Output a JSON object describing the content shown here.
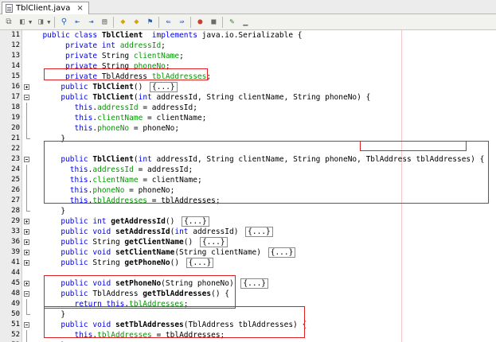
{
  "tab": {
    "label": "TblClient.java",
    "close": "×"
  },
  "toolbar": {
    "icons": [
      "history-icon",
      "back-icon",
      "forward-icon",
      "find-icon",
      "find-prev-icon",
      "find-next-icon",
      "toggle-highlight-icon",
      "prev-bookmark-icon",
      "next-bookmark-icon",
      "toggle-bookmark-icon",
      "shift-left-icon",
      "shift-right-icon",
      "record-macro-icon",
      "stop-macro-icon",
      "comment-icon",
      "uncomment-icon"
    ]
  },
  "editor": {
    "lines": [
      {
        "n": "11",
        "fold": "",
        "indent": "  ",
        "tokens": [
          [
            "kw",
            "public class "
          ],
          [
            "b",
            "TblClient"
          ],
          [
            "",
            "  "
          ],
          [
            "kw",
            "implements"
          ],
          [
            "",
            " java.io.Serializable {"
          ]
        ]
      },
      {
        "n": "12",
        "fold": "",
        "indent": "       ",
        "tokens": [
          [
            "kw",
            "private int "
          ],
          [
            "fld",
            "addressId"
          ],
          [
            "",
            ";"
          ]
        ]
      },
      {
        "n": "13",
        "fold": "",
        "indent": "       ",
        "tokens": [
          [
            "kw",
            "private "
          ],
          [
            "",
            "String "
          ],
          [
            "fld",
            "clientName"
          ],
          [
            "",
            ";"
          ]
        ]
      },
      {
        "n": "14",
        "fold": "",
        "indent": "       ",
        "tokens": [
          [
            "kw",
            "private "
          ],
          [
            "",
            "String "
          ],
          [
            "fld",
            "phoneNo"
          ],
          [
            "",
            ";"
          ]
        ]
      },
      {
        "n": "15",
        "fold": "",
        "indent": "       ",
        "tokens": [
          [
            "kw",
            "private "
          ],
          [
            "",
            "TblAddress "
          ],
          [
            "fld",
            "tblAddresses"
          ],
          [
            "",
            ";"
          ]
        ]
      },
      {
        "n": "16",
        "fold": "plus",
        "indent": "      ",
        "tokens": [
          [
            "kw",
            "public "
          ],
          [
            "b",
            "TblClient"
          ],
          [
            "",
            "() "
          ]
        ],
        "collapsed": "{...}"
      },
      {
        "n": "17",
        "fold": "minus",
        "indent": "      ",
        "tokens": [
          [
            "kw",
            "public "
          ],
          [
            "b",
            "TblClient"
          ],
          [
            "",
            "("
          ],
          [
            "kw",
            "int"
          ],
          [
            "",
            " addressId, String clientName, String phoneNo) {"
          ]
        ]
      },
      {
        "n": "18",
        "fold": "",
        "indent": "         ",
        "tokens": [
          [
            "kw",
            "this"
          ],
          [
            "",
            "."
          ],
          [
            "fld",
            "addressId"
          ],
          [
            "",
            " = addressId;"
          ]
        ]
      },
      {
        "n": "19",
        "fold": "",
        "indent": "         ",
        "tokens": [
          [
            "kw",
            "this"
          ],
          [
            "",
            "."
          ],
          [
            "fld",
            "clientName"
          ],
          [
            "",
            " = clientName;"
          ]
        ]
      },
      {
        "n": "20",
        "fold": "",
        "indent": "         ",
        "tokens": [
          [
            "kw",
            "this"
          ],
          [
            "",
            "."
          ],
          [
            "fld",
            "phoneNo"
          ],
          [
            "",
            " = phoneNo;"
          ]
        ]
      },
      {
        "n": "21",
        "fold": "end",
        "indent": "      ",
        "tokens": [
          [
            "",
            "}"
          ]
        ]
      },
      {
        "n": "22",
        "fold": "",
        "indent": "",
        "tokens": []
      },
      {
        "n": "23",
        "fold": "minus",
        "indent": "      ",
        "tokens": [
          [
            "kw",
            "public "
          ],
          [
            "b",
            "TblClient"
          ],
          [
            "",
            "("
          ],
          [
            "kw",
            "int"
          ],
          [
            "",
            " addressId, String clientName, String phoneNo, TblAddress tblAddresses) {"
          ]
        ]
      },
      {
        "n": "24",
        "fold": "",
        "indent": "        ",
        "tokens": [
          [
            "kw",
            "this"
          ],
          [
            "",
            "."
          ],
          [
            "fld",
            "addressId"
          ],
          [
            "",
            " = addressId;"
          ]
        ]
      },
      {
        "n": "25",
        "fold": "",
        "indent": "        ",
        "tokens": [
          [
            "kw",
            "this"
          ],
          [
            "",
            "."
          ],
          [
            "fld",
            "clientName"
          ],
          [
            "",
            " = clientName;"
          ]
        ]
      },
      {
        "n": "26",
        "fold": "",
        "indent": "        ",
        "tokens": [
          [
            "kw",
            "this"
          ],
          [
            "",
            "."
          ],
          [
            "fld",
            "phoneNo"
          ],
          [
            "",
            " = phoneNo;"
          ]
        ]
      },
      {
        "n": "27",
        "fold": "",
        "indent": "        ",
        "tokens": [
          [
            "kw",
            "this"
          ],
          [
            "",
            "."
          ],
          [
            "fld",
            "tblAddresses"
          ],
          [
            "",
            " = tblAddresses;"
          ]
        ]
      },
      {
        "n": "28",
        "fold": "end",
        "indent": "      ",
        "tokens": [
          [
            "",
            "}"
          ]
        ]
      },
      {
        "n": "29",
        "fold": "plus",
        "indent": "      ",
        "tokens": [
          [
            "kw",
            "public int "
          ],
          [
            "b",
            "getAddressId"
          ],
          [
            "",
            "() "
          ]
        ],
        "collapsed": "{...}"
      },
      {
        "n": "33",
        "fold": "plus",
        "indent": "      ",
        "tokens": [
          [
            "kw",
            "public void "
          ],
          [
            "b",
            "setAddressId"
          ],
          [
            "",
            "("
          ],
          [
            "kw",
            "int"
          ],
          [
            "",
            " addressId) "
          ]
        ],
        "collapsed": "{...}"
      },
      {
        "n": "36",
        "fold": "plus",
        "indent": "      ",
        "tokens": [
          [
            "kw",
            "public "
          ],
          [
            "",
            "String "
          ],
          [
            "b",
            "getClientName"
          ],
          [
            "",
            "() "
          ]
        ],
        "collapsed": "{...}"
      },
      {
        "n": "39",
        "fold": "plus",
        "indent": "      ",
        "tokens": [
          [
            "kw",
            "public void "
          ],
          [
            "b",
            "setClientName"
          ],
          [
            "",
            "(String clientName) "
          ]
        ],
        "collapsed": "{...}"
      },
      {
        "n": "41",
        "fold": "plus",
        "indent": "      ",
        "tokens": [
          [
            "kw",
            "public "
          ],
          [
            "",
            "String "
          ],
          [
            "b",
            "getPhoneNo"
          ],
          [
            "",
            "() "
          ]
        ],
        "collapsed": "{...}"
      },
      {
        "n": "44",
        "fold": "",
        "indent": "",
        "tokens": []
      },
      {
        "n": "45",
        "fold": "plus",
        "indent": "      ",
        "tokens": [
          [
            "kw",
            "public void "
          ],
          [
            "b",
            "setPhoneNo"
          ],
          [
            "",
            "(String phoneNo) "
          ]
        ],
        "collapsed": "{...}"
      },
      {
        "n": "48",
        "fold": "minus",
        "indent": "      ",
        "tokens": [
          [
            "kw",
            "public "
          ],
          [
            "",
            "TblAddress "
          ],
          [
            "b",
            "getTblAddresses"
          ],
          [
            "",
            "() {"
          ]
        ]
      },
      {
        "n": "49",
        "fold": "",
        "indent": "         ",
        "tokens": [
          [
            "kw",
            "return this"
          ],
          [
            "",
            "."
          ],
          [
            "fld",
            "tblAddresses"
          ],
          [
            "",
            ";"
          ]
        ]
      },
      {
        "n": "50",
        "fold": "end",
        "indent": "      ",
        "tokens": [
          [
            "",
            "}"
          ]
        ]
      },
      {
        "n": "51",
        "fold": "minus",
        "indent": "      ",
        "tokens": [
          [
            "kw",
            "public void "
          ],
          [
            "b",
            "setTblAddresses"
          ],
          [
            "",
            "(TblAddress tblAddresses) {"
          ]
        ]
      },
      {
        "n": "52",
        "fold": "",
        "indent": "         ",
        "tokens": [
          [
            "kw",
            "this"
          ],
          [
            "",
            "."
          ],
          [
            "fld",
            "tblAddresses"
          ],
          [
            "",
            " = tblAddresses;"
          ]
        ]
      },
      {
        "n": "53",
        "fold": "end",
        "indent": "      ",
        "tokens": [
          [
            "",
            "}"
          ]
        ]
      }
    ]
  },
  "colors": {
    "keyword": "#0000e6",
    "field": "#009900",
    "highlight_box": "#e02020"
  }
}
